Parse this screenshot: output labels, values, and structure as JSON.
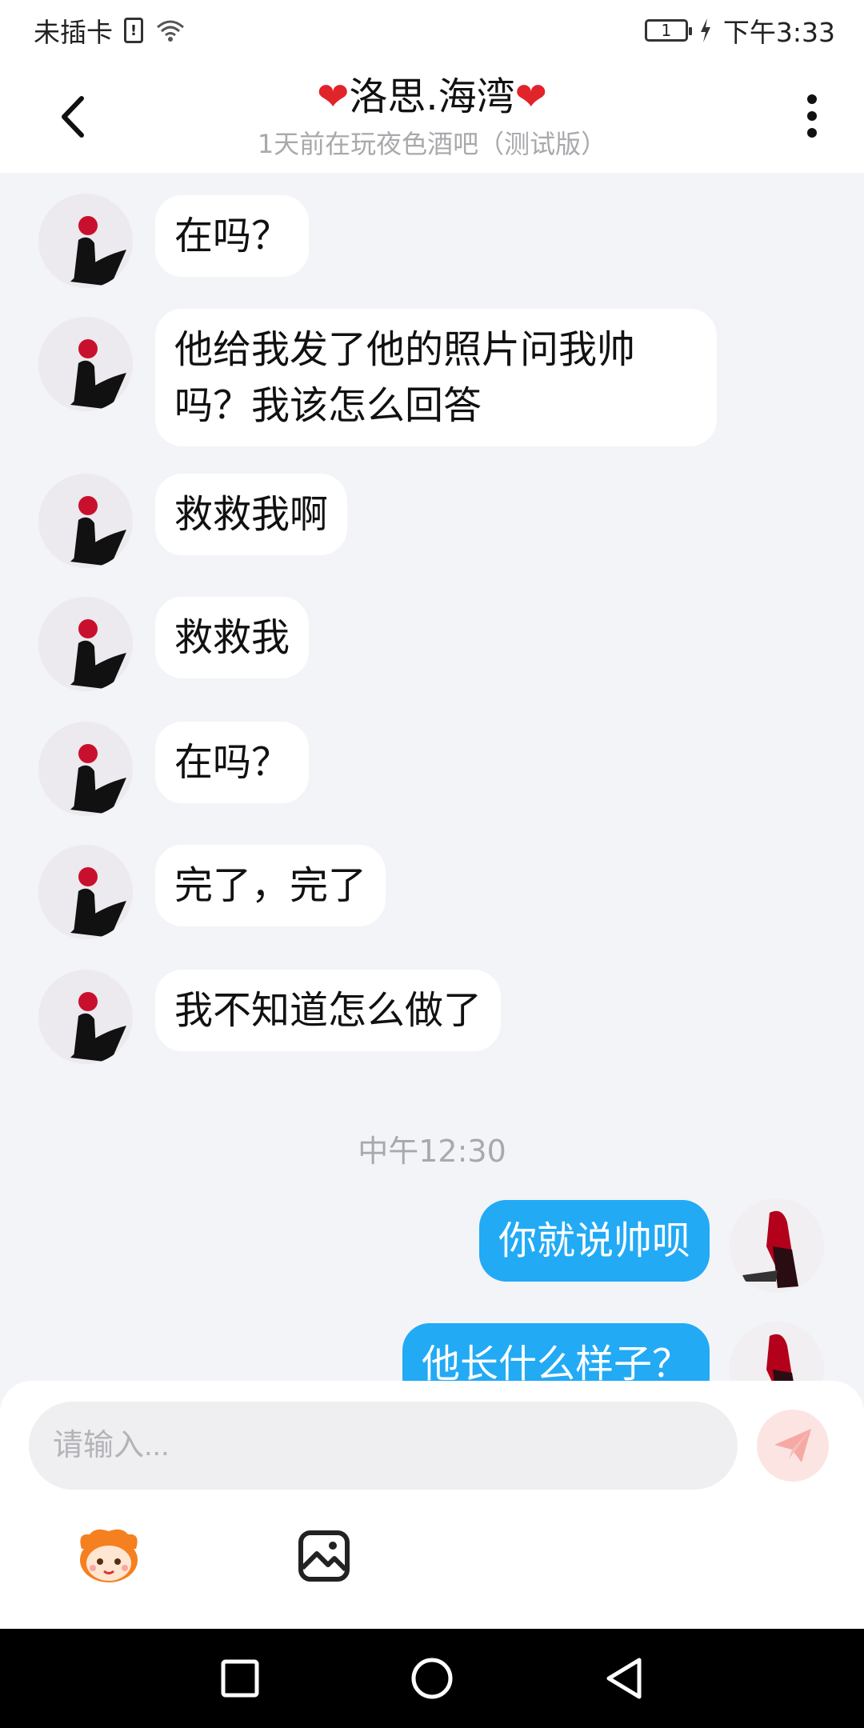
{
  "status_bar": {
    "carrier": "未插卡",
    "battery_level": "1",
    "time": "下午3:33"
  },
  "header": {
    "title": "洛思.海湾",
    "heart_left": "❤",
    "heart_right": "❤",
    "subtitle": "1天前在玩夜色酒吧（测试版）"
  },
  "messages": [
    {
      "sender": "other",
      "text": "在吗？"
    },
    {
      "sender": "other",
      "text": "他给我发了他的照片问我帅吗？我该怎么回答"
    },
    {
      "sender": "other",
      "text": "救救我啊"
    },
    {
      "sender": "other",
      "text": "救救我"
    },
    {
      "sender": "other",
      "text": "在吗？"
    },
    {
      "sender": "other",
      "text": "完了，完了"
    },
    {
      "sender": "other",
      "text": "我不知道怎么做了"
    },
    {
      "sender": "system_time",
      "text": "中午12:30"
    },
    {
      "sender": "me",
      "text": "你就说帅呗"
    },
    {
      "sender": "me",
      "text": "他长什么样子？"
    }
  ],
  "input": {
    "placeholder": "请输入..."
  },
  "icons": {
    "back": "chevron-left-icon",
    "more": "more-vertical-icon",
    "send": "send-icon",
    "emoji": "emoji-mascot-icon",
    "image": "image-icon",
    "nav_recent": "square-icon",
    "nav_home": "circle-icon",
    "nav_back": "triangle-back-icon"
  },
  "colors": {
    "my_bubble": "#22aaf5",
    "other_bubble": "#ffffff",
    "heart": "#e0242a",
    "send_bg": "#fce4e3",
    "send_icon": "#f6a9a3"
  }
}
